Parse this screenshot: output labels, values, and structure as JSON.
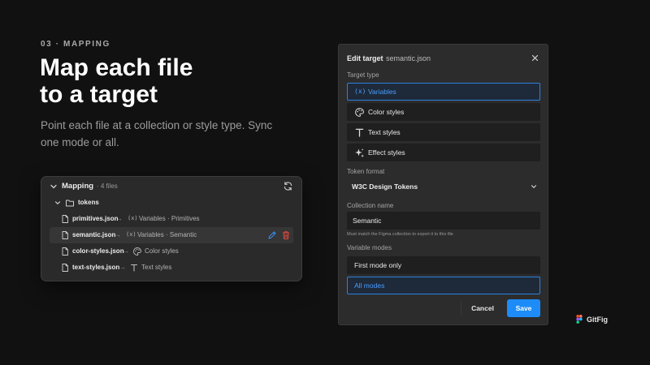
{
  "hero": {
    "eyebrow": "03 · MAPPING",
    "headline_line1": "Map each file",
    "headline_line2": "to a target",
    "subline": "Point each file at a collection or style type. Sync one mode or all."
  },
  "mapping": {
    "title": "Mapping",
    "count": "· 4 files",
    "folder": "tokens",
    "rows": [
      {
        "file": "primitives.json",
        "arrow": "→",
        "target": "Variables · Primitives",
        "target_icon": "variable-icon"
      },
      {
        "file": "semantic.json",
        "arrow": "→",
        "target": "Variables · Semantic",
        "target_icon": "variable-icon",
        "selected": true
      },
      {
        "file": "color-styles.json",
        "arrow": "→",
        "target": "Color styles",
        "target_icon": "palette-icon"
      },
      {
        "file": "text-styles.json",
        "arrow": "→",
        "target": "Text styles",
        "target_icon": "text-icon"
      }
    ]
  },
  "dialog": {
    "title": "Edit target",
    "file": "semantic.json",
    "target_type_label": "Target type",
    "target_types": [
      {
        "label": "Variables",
        "icon": "variable-icon",
        "active": true
      },
      {
        "label": "Color styles",
        "icon": "palette-icon",
        "active": false
      },
      {
        "label": "Text styles",
        "icon": "text-icon",
        "active": false
      },
      {
        "label": "Effect styles",
        "icon": "sparkle-icon",
        "active": false
      }
    ],
    "token_format_label": "Token format",
    "token_format_value": "W3C Design Tokens",
    "collection_label": "Collection name",
    "collection_value": "Semantic",
    "collection_hint": "Must match the Figma collection to export it to this file",
    "modes_label": "Variable modes",
    "modes": [
      {
        "label": "First mode only",
        "active": false
      },
      {
        "label": "All modes",
        "active": true
      }
    ],
    "cancel": "Cancel",
    "save": "Save"
  },
  "brand": {
    "name": "GitFig"
  },
  "colors": {
    "accent": "#1d8cf8",
    "accent_text": "#4a9cff",
    "danger": "#e5483d",
    "background": "#111111"
  }
}
